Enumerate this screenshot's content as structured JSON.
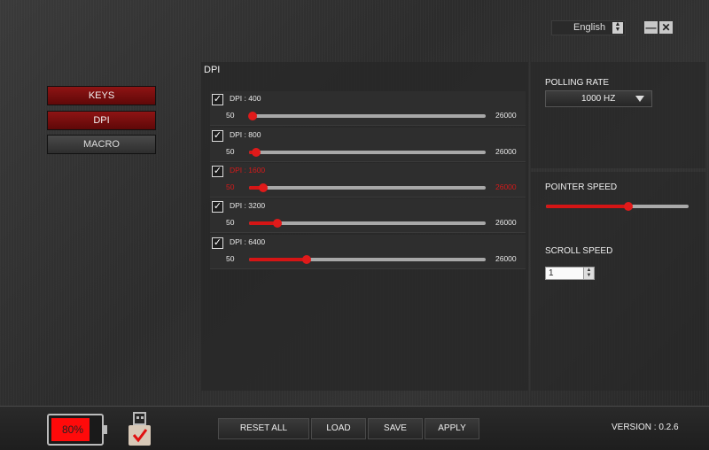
{
  "language": {
    "value": "English"
  },
  "window_controls": {
    "minimize": "—",
    "close": "✕"
  },
  "menu": [
    {
      "label": "KEYS",
      "active": true
    },
    {
      "label": "DPI",
      "active": true
    },
    {
      "label": "MACRO",
      "active": false
    }
  ],
  "dpi": {
    "title": "DPI",
    "min_label": "50",
    "max_label": "26000",
    "rows": [
      {
        "label": "DPI : 400",
        "value": 400,
        "checked": true,
        "highlighted": false
      },
      {
        "label": "DPI : 800",
        "value": 800,
        "checked": true,
        "highlighted": false
      },
      {
        "label": "DPI : 1600",
        "value": 1600,
        "checked": true,
        "highlighted": true
      },
      {
        "label": "DPI : 3200",
        "value": 3200,
        "checked": true,
        "highlighted": false
      },
      {
        "label": "DPI : 6400",
        "value": 6400,
        "checked": true,
        "highlighted": false
      }
    ]
  },
  "polling_rate": {
    "title": "POLLING RATE",
    "value": "1000 HZ"
  },
  "pointer_speed": {
    "title": "POINTER SPEED",
    "level": 0.58
  },
  "scroll_speed": {
    "title": "SCROLL SPEED",
    "value": "1"
  },
  "battery": {
    "percent_label": "80%",
    "level": 0.8
  },
  "footer": {
    "reset_all": "RESET ALL",
    "load": "LOAD",
    "save": "SAVE",
    "apply": "APPLY",
    "version": "VERSION : 0.2.6"
  },
  "colors": {
    "accent": "#d51515",
    "active_button": "#7a1010"
  }
}
